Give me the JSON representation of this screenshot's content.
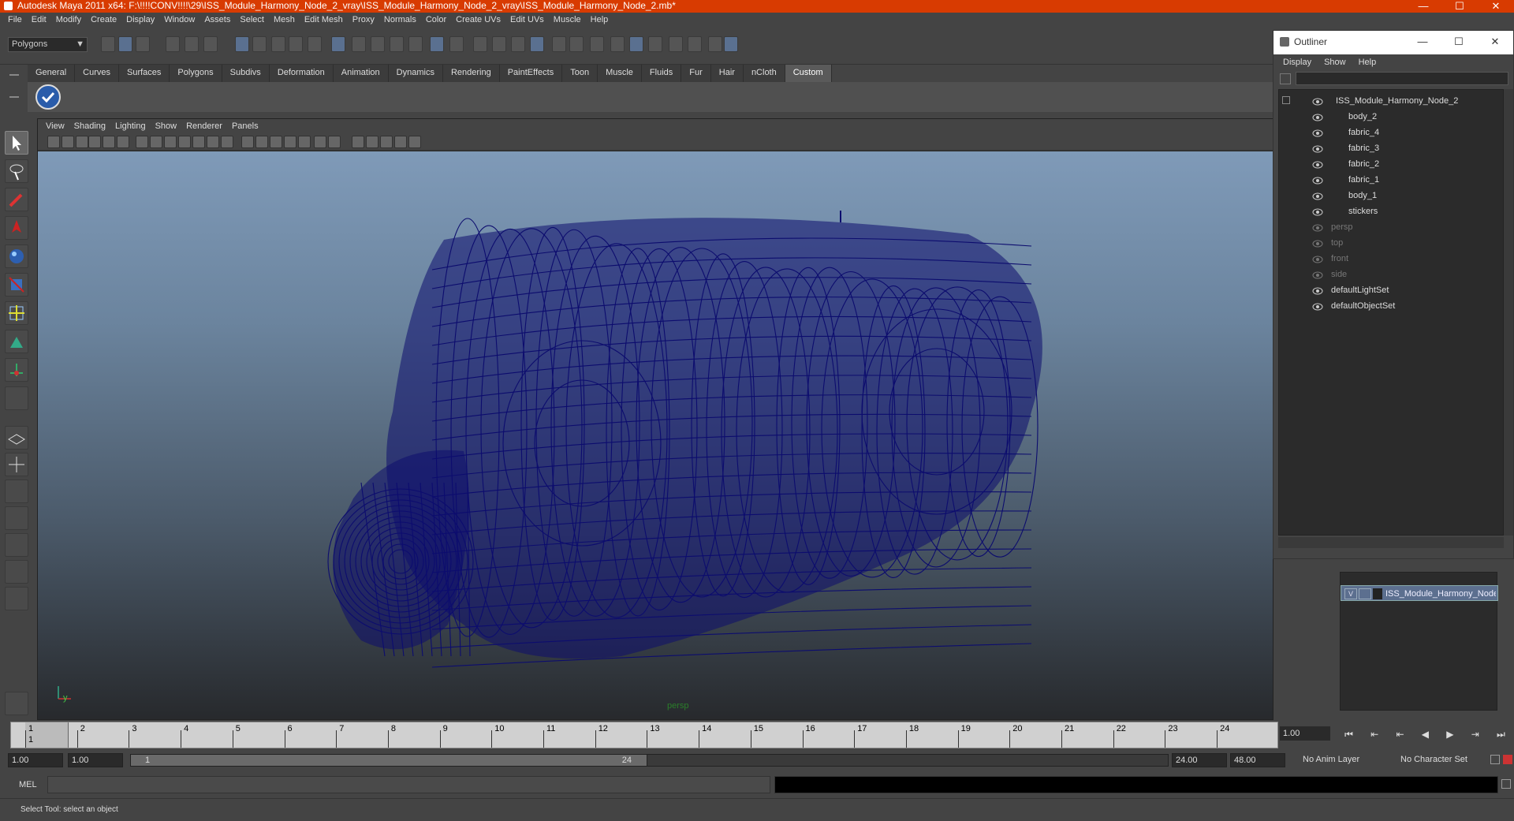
{
  "window": {
    "title": "Autodesk Maya 2011 x64: F:\\!!!!CONV!!!!\\29\\ISS_Module_Harmony_Node_2_vray\\ISS_Module_Harmony_Node_2_vray\\ISS_Module_Harmony_Node_2.mb*",
    "minimize": "—",
    "maximize": "☐",
    "close": "✕"
  },
  "menu": [
    "File",
    "Edit",
    "Modify",
    "Create",
    "Display",
    "Window",
    "Assets",
    "Select",
    "Mesh",
    "Edit Mesh",
    "Proxy",
    "Normals",
    "Color",
    "Create UVs",
    "Edit UVs",
    "Muscle",
    "Help"
  ],
  "statusline": {
    "menuset": "Polygons",
    "chevron": "▼"
  },
  "shelf": {
    "tabs": [
      "General",
      "Curves",
      "Surfaces",
      "Polygons",
      "Subdivs",
      "Deformation",
      "Animation",
      "Dynamics",
      "Rendering",
      "PaintEffects",
      "Toon",
      "Muscle",
      "Fluids",
      "Fur",
      "Hair",
      "nCloth",
      "Custom"
    ],
    "active_tab": "Custom"
  },
  "viewport": {
    "menu": [
      "View",
      "Shading",
      "Lighting",
      "Show",
      "Renderer",
      "Panels"
    ],
    "camera": "persp",
    "axis_label": "y",
    "wire_color": "#0c0c6e"
  },
  "outliner": {
    "title": "Outliner",
    "menu": [
      "Display",
      "Show",
      "Help"
    ],
    "root": "ISS_Module_Harmony_Node_2",
    "children": [
      "body_2",
      "fabric_4",
      "fabric_3",
      "fabric_2",
      "fabric_1",
      "body_1",
      "stickers"
    ],
    "cameras": [
      "persp",
      "top",
      "front",
      "side"
    ],
    "sets": [
      "defaultLightSet",
      "defaultObjectSet"
    ]
  },
  "layers": {
    "name": "ISS_Module_Harmony_Node_2",
    "visible_flag": "V"
  },
  "timeslider": {
    "ticks": [
      "1",
      "2",
      "3",
      "4",
      "5",
      "6",
      "7",
      "8",
      "9",
      "10",
      "11",
      "12",
      "13",
      "14",
      "15",
      "16",
      "17",
      "18",
      "19",
      "20",
      "21",
      "22",
      "23",
      "24"
    ],
    "current_mark": "1",
    "current_frame": "1.00",
    "playback": [
      "⏮",
      "⇤",
      "⇤",
      "◀",
      "▶",
      "⇥",
      "⏭"
    ]
  },
  "range": {
    "start": "1.00",
    "playback_start": "1.00",
    "range_start": "1",
    "range_end": "24",
    "playback_end": "24.00",
    "end": "48.00",
    "anim_layer": "No Anim Layer",
    "character_set": "No Character Set"
  },
  "cmd": {
    "label": "MEL"
  },
  "help": {
    "text": "Select Tool: select an object"
  }
}
